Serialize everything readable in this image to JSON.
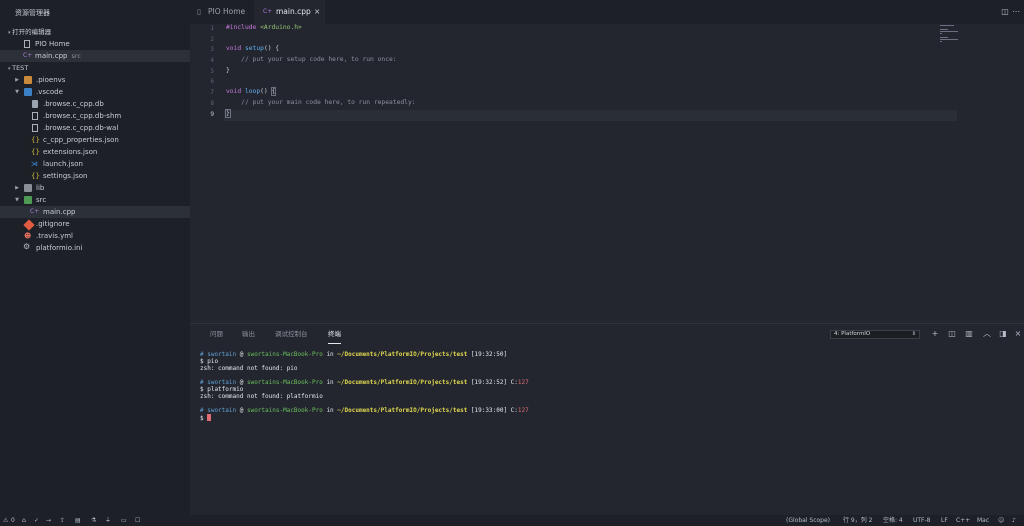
{
  "sidebar": {
    "title": "资源管理器",
    "open_editors_header": "打开的编辑器",
    "open_editors": [
      {
        "label": "PIO Home",
        "desc": ""
      },
      {
        "label": "main.cpp",
        "desc": "src"
      }
    ],
    "workspace_header": "TEST",
    "tree": [
      {
        "label": ".pioenvs",
        "icon": "folder-icon"
      },
      {
        "label": ".vscode",
        "icon": "vscode-folder-icon"
      },
      {
        "label": ".browse.c_cpp.db",
        "icon": "database-icon"
      },
      {
        "label": ".browse.c_cpp.db-shm",
        "icon": "file-icon"
      },
      {
        "label": ".browse.c_cpp.db-wal",
        "icon": "file-icon"
      },
      {
        "label": "c_cpp_properties.json",
        "icon": "json-icon"
      },
      {
        "label": "extensions.json",
        "icon": "json-icon"
      },
      {
        "label": "launch.json",
        "icon": "vscode-icon"
      },
      {
        "label": "settings.json",
        "icon": "json-icon"
      },
      {
        "label": "lib",
        "icon": "folder-icon"
      },
      {
        "label": "src",
        "icon": "src-folder-icon"
      },
      {
        "label": "main.cpp",
        "icon": "cpp-file-icon"
      },
      {
        "label": ".gitignore",
        "icon": "git-icon"
      },
      {
        "label": ".travis.yml",
        "icon": "travis-icon"
      },
      {
        "label": "platformio.ini",
        "icon": "gear-icon"
      }
    ]
  },
  "tabs": [
    {
      "label": "PIO Home",
      "icon": "file-icon"
    },
    {
      "label": "main.cpp",
      "icon": "cpp-file-icon",
      "close": "×"
    }
  ],
  "editor": {
    "line_numbers": [
      "1",
      "2",
      "3",
      "4",
      "5",
      "6",
      "7",
      "8",
      "9"
    ],
    "current_line": "9",
    "lines": [
      {
        "t": "#include <Arduino.h>"
      },
      {
        "t": ""
      },
      {
        "t": "void setup() {"
      },
      {
        "t": "    // put your setup code here, to run once:"
      },
      {
        "t": "}"
      },
      {
        "t": ""
      },
      {
        "t": "void loop() {"
      },
      {
        "t": "    // put your main code here, to run repeatedly:"
      },
      {
        "t": "}"
      }
    ]
  },
  "panel": {
    "tabs": [
      "问题",
      "输出",
      "调试控制台",
      "终端"
    ],
    "active_tab": "终端",
    "terminal_select": "4: PlatformIO",
    "terminal_lines": [
      "# swortain @ swortains-MacBook-Pro in ~/Documents/PlatformIO/Projects/test [19:32:50]",
      "$ pio",
      "zsh: command not found: pio",
      "",
      "# swortain @ swortains-MacBook-Pro in ~/Documents/PlatformIO/Projects/test [19:32:52] C:127",
      "$ platformio",
      "zsh: command not found: platformio",
      "",
      "# swortain @ swortains-MacBook-Pro in ~/Documents/PlatformIO/Projects/test [19:33:00] C:127",
      "$ "
    ]
  },
  "status": {
    "errors": "0",
    "warnings": "0",
    "scope": "(Global Scope)",
    "position": "行 9，列 2",
    "spaces": "空格: 4",
    "encoding": "UTF-8",
    "eol": "LF",
    "language": "C++",
    "platform": "Mac"
  }
}
